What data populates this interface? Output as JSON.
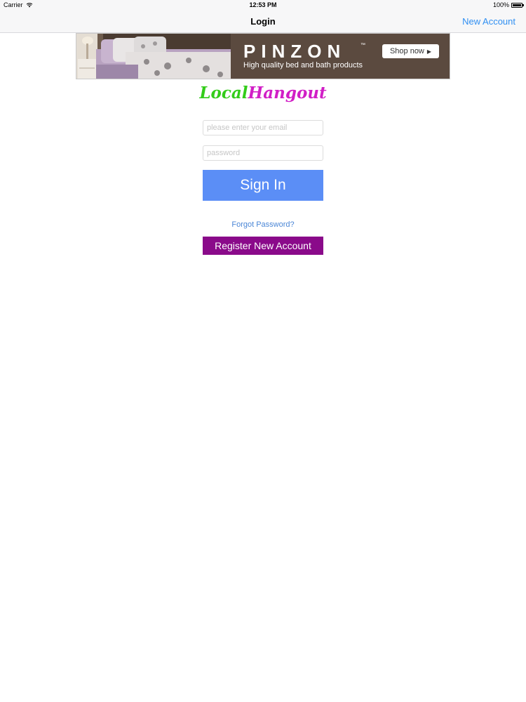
{
  "status_bar": {
    "carrier": "Carrier",
    "time": "12:53 PM",
    "battery": "100%",
    "battery_level": 1.0
  },
  "nav_bar": {
    "title": "Login",
    "right_button": "New Account"
  },
  "ad": {
    "brand": "PINZON",
    "trademark": "™",
    "tagline": "High quality bed and bath products",
    "cta": "Shop now"
  },
  "logo": {
    "part1": "Local",
    "part2": "Hangout"
  },
  "form": {
    "email_placeholder": "please enter your email",
    "email_value": "",
    "password_placeholder": "password",
    "password_value": "",
    "sign_in": "Sign In",
    "forgot": "Forgot Password?",
    "register": "Register New Account"
  },
  "colors": {
    "nav_link": "#2f8ff2",
    "sign_in_bg": "#5b8ef6",
    "register_bg": "#8a0a8a",
    "logo_green": "#33cc1a",
    "logo_magenta": "#d11fc6",
    "link": "#4a86d6"
  }
}
